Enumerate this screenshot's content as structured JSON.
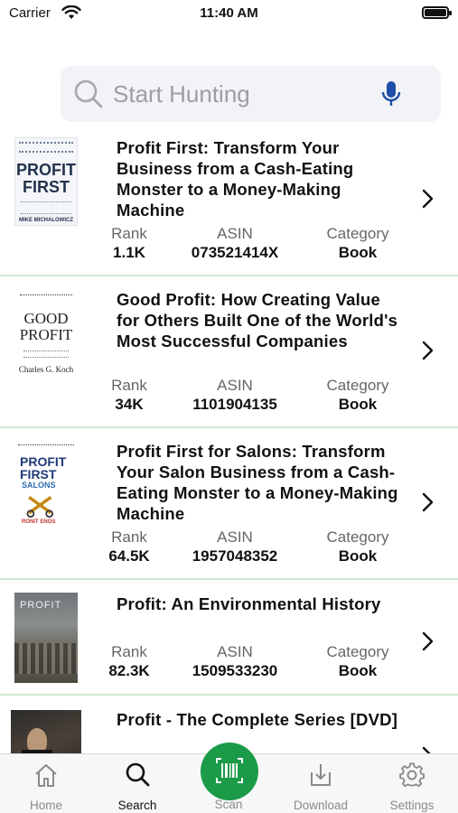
{
  "status_bar": {
    "carrier": "Carrier",
    "time": "11:40 AM"
  },
  "search": {
    "placeholder": "Start Hunting",
    "value": ""
  },
  "labels": {
    "rank": "Rank",
    "asin": "ASIN",
    "category": "Category"
  },
  "results": [
    {
      "title": "Profit First: Transform Your Business from a Cash-Eating Monster to a Money-Making Machine",
      "rank": "1.1K",
      "asin": "073521414X",
      "category": "Book",
      "cover": {
        "line1": "PROFIT",
        "line2": "FIRST",
        "author": "MIKE MICHALOWICZ"
      }
    },
    {
      "title": "Good Profit: How Creating Value for Others Built One of the World's Most Successful Companies",
      "rank": "34K",
      "asin": "1101904135",
      "category": "Book",
      "cover": {
        "line1": "GOOD",
        "line2": "PROFIT",
        "author": "Charles G. Koch"
      }
    },
    {
      "title": "Profit First for Salons: Transform Your Salon Business from a Cash-Eating Monster to a Money-Making Machine",
      "rank": "64.5K",
      "asin": "1957048352",
      "category": "Book",
      "cover": {
        "line1": "PROFIT",
        "line2": "FIRST",
        "line3": "SALONS",
        "author": "RONIT ENOS"
      }
    },
    {
      "title": "Profit: An Environmental History",
      "rank": "82.3K",
      "asin": "1509533230",
      "category": "Book",
      "cover": {
        "line1": "PROFIT"
      }
    },
    {
      "title": "Profit - The Complete Series [DVD]"
    }
  ],
  "tabs": [
    {
      "label": "Home",
      "icon": "home-icon",
      "active": false
    },
    {
      "label": "Search",
      "icon": "search-icon",
      "active": true
    },
    {
      "label": "Scan",
      "icon": "barcode-icon",
      "active": false
    },
    {
      "label": "Download",
      "icon": "download-icon",
      "active": false
    },
    {
      "label": "Settings",
      "icon": "gear-icon",
      "active": false
    }
  ],
  "colors": {
    "accent": "#1b9a48",
    "divider": "#cfe9d4",
    "search_bg": "#f2f3f6",
    "mic": "#1e4fa8"
  }
}
